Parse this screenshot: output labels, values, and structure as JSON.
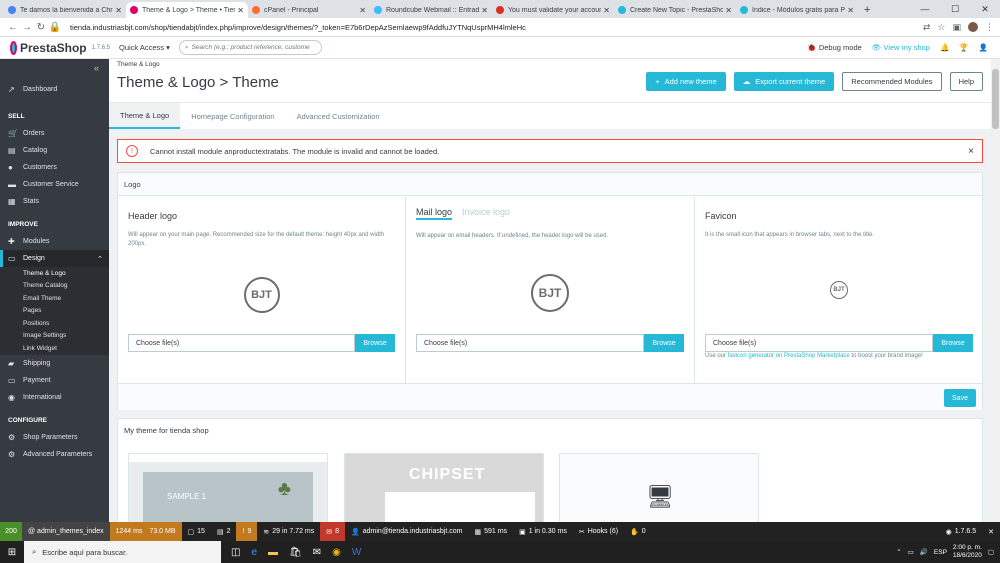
{
  "browser": {
    "tabs": [
      {
        "title": "Te damos la bienvenida a Chrome",
        "color": "#4285f4",
        "active": false
      },
      {
        "title": "Theme & Logo > Theme • Tienda",
        "color": "#df0067",
        "active": true
      },
      {
        "title": "cPanel - Principal",
        "color": "#ff6c2c",
        "active": false
      },
      {
        "title": "Roundcube Webmail :: Entrada",
        "color": "#37beff",
        "active": false
      },
      {
        "title": "You must validate your account",
        "color": "#d93025",
        "active": false
      },
      {
        "title": "Create New Topic - PrestaShop",
        "color": "#25b9d7",
        "active": false
      },
      {
        "title": "Índice - Módulos gratis para Pre",
        "color": "#25b9d7",
        "active": false
      }
    ],
    "url": "tienda.industriasbjt.com/shop/tiendabjt/index.php/improve/design/themes/?_token=E7b6rDepAzSemlaewp9fAddfuJYTNqUsprMH4lmleHc"
  },
  "topbar": {
    "brand": "PrestaShop",
    "version": "1.7.6.5",
    "quick_access": "Quick Access ▾",
    "search_placeholder": "Search (e.g.: product reference, custome",
    "debug_mode": "Debug mode",
    "view_shop": "View my shop"
  },
  "sidebar": {
    "dashboard": "Dashboard",
    "sell_title": "SELL",
    "sell": [
      "Orders",
      "Catalog",
      "Customers",
      "Customer Service",
      "Stats"
    ],
    "improve_title": "IMPROVE",
    "modules": "Modules",
    "design": "Design",
    "design_sub": [
      "Theme & Logo",
      "Theme Catalog",
      "Email Theme",
      "Pages",
      "Positions",
      "Image Settings",
      "Link Widget"
    ],
    "after": [
      "Shipping",
      "Payment",
      "International"
    ],
    "configure_title": "CONFIGURE",
    "configure": [
      "Shop Parameters",
      "Advanced Parameters"
    ]
  },
  "header": {
    "breadcrumb": "Theme & Logo",
    "title": "Theme & Logo > Theme",
    "add_theme": "Add new theme",
    "export_theme": "Export current theme",
    "recommended": "Recommended Modules",
    "help": "Help"
  },
  "subtabs": [
    "Theme & Logo",
    "Homepage Configuration",
    "Advanced Customization"
  ],
  "alert": "Cannot install module anproductextratabs. The module is invalid and cannot be loaded.",
  "logo_card": {
    "title": "Logo",
    "header_logo": {
      "title": "Header logo",
      "desc": "Will appear on your main page. Recommended size for the default theme: height 40px and width 200px."
    },
    "mail_logo": {
      "tab_on": "Mail logo",
      "tab_off": "Invoice logo",
      "desc": "Will appear on email headers. If undefined, the header logo will be used."
    },
    "favicon": {
      "title": "Favicon",
      "desc": "It is the small icon that appears in browser tabs, next to the title.",
      "note_pre": "Use our ",
      "note_link": "favicon generator on PrestaShop Marketplace",
      "note_post": " to boost your brand image!"
    },
    "logo_text": "BJT",
    "choose": "Choose file(s)",
    "browse": "Browse",
    "save": "Save"
  },
  "themes_card": {
    "title": "My theme for tienda shop",
    "thumb1_text": "SAMPLE 1",
    "thumb2_text": "CHIPSET"
  },
  "debugbar": {
    "status": "200",
    "route": "@ admin_themes_index",
    "time": "1244 ms",
    "memory": "73.0 MB",
    "c1": "15",
    "c2": "2",
    "c3": "9",
    "queries": "29 in 7.72 ms",
    "errors": "8",
    "user": "admin@tienda.industriasbjt.com",
    "ms": "591 ms",
    "cache": "1 in 0.30 ms",
    "hooks": "Hooks (6)",
    "zero": "0",
    "ver": "1.7.6.5"
  },
  "taskbar": {
    "search": "Escribe aquí para buscar.",
    "lang": "ESP",
    "time": "2:00 p. m.",
    "date": "18/6/2020"
  }
}
